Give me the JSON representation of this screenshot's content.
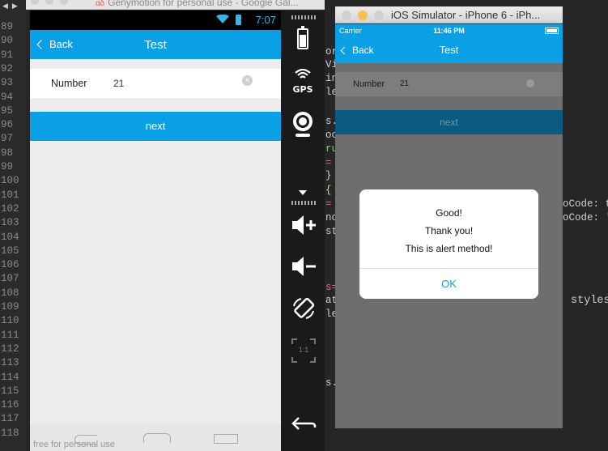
{
  "gutter": {
    "lines": [
      "89",
      "90",
      "91",
      "92",
      "93",
      "94",
      "95",
      "96",
      "97",
      "98",
      "99",
      "100",
      "101",
      "102",
      "103",
      "104",
      "105",
      "106",
      "107",
      "108",
      "109",
      "110",
      "111",
      "112",
      "113",
      "114",
      "115",
      "116",
      "117",
      "118"
    ]
  },
  "android": {
    "window_title_prefix": "ɑδ",
    "window_title": "Genymotion for personal use - Google Gal...",
    "status_time": "7:07",
    "nav_back": "Back",
    "nav_title": "Test",
    "form_label": "Number",
    "form_value": "21",
    "next_button": "next",
    "footnote": "free for personal use"
  },
  "genymotion": {
    "gps_label": "GPS",
    "scale_label": "1:1"
  },
  "ios": {
    "window_title": "iOS Simulator - iPhone 6 - iPh...",
    "carrier": "Carrier",
    "status_time": "11:46 PM",
    "nav_back": "Back",
    "nav_title": "Test",
    "form_label": "Number",
    "form_value": "21",
    "next_button": "next",
    "alert": {
      "title": "Good!",
      "message_line1": "Thank you!",
      "message_line2": "This is alert method!",
      "ok_button": "OK"
    }
  },
  "background_code": {
    "frag_or": "or",
    "frag_vi": "Vi",
    "frag_in": "in",
    "frag_le1": "le",
    "frag_s1": "s.",
    "frag_oc": "oc",
    "frag_ru": "ru",
    "frag_eq1": "=",
    "frag_brace": "}",
    "frag_brace2": "{",
    "frag_eq2": "=",
    "frag_no": "no",
    "frag_st": "st",
    "frag_s2": "s=",
    "frag_at": "at",
    "frag_le2": "le",
    "frag_s3": "s.",
    "frag_code1": "oCode: t",
    "frag_code2": "oCode: '",
    "frag_styles": "styles"
  },
  "colors": {
    "accent_blue": "#0aa0e6",
    "status_cyan": "#33b5e5"
  }
}
